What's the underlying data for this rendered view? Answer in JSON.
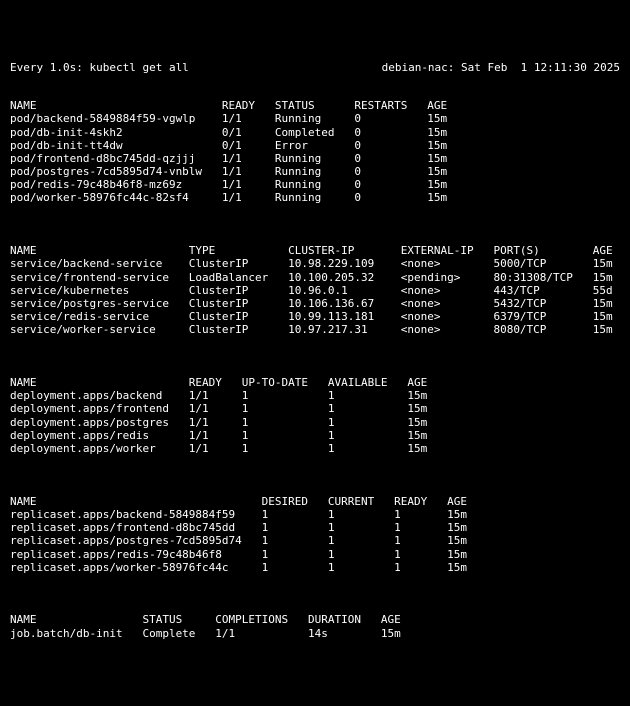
{
  "header": {
    "left": "Every 1.0s: kubectl get all",
    "right": "debian-nac: Sat Feb  1 12:11:30 2025"
  },
  "pods": {
    "headers": [
      "NAME",
      "READY",
      "STATUS",
      "RESTARTS",
      "AGE"
    ],
    "rows": [
      [
        "pod/backend-5849884f59-vgwlp",
        "1/1",
        "Running",
        "0",
        "15m"
      ],
      [
        "pod/db-init-4skh2",
        "0/1",
        "Completed",
        "0",
        "15m"
      ],
      [
        "pod/db-init-tt4dw",
        "0/1",
        "Error",
        "0",
        "15m"
      ],
      [
        "pod/frontend-d8bc745dd-qzjjj",
        "1/1",
        "Running",
        "0",
        "15m"
      ],
      [
        "pod/postgres-7cd5895d74-vnblw",
        "1/1",
        "Running",
        "0",
        "15m"
      ],
      [
        "pod/redis-79c48b46f8-mz69z",
        "1/1",
        "Running",
        "0",
        "15m"
      ],
      [
        "pod/worker-58976fc44c-82sf4",
        "1/1",
        "Running",
        "0",
        "15m"
      ]
    ]
  },
  "services": {
    "headers": [
      "NAME",
      "TYPE",
      "CLUSTER-IP",
      "EXTERNAL-IP",
      "PORT(S)",
      "AGE"
    ],
    "rows": [
      [
        "service/backend-service",
        "ClusterIP",
        "10.98.229.109",
        "<none>",
        "5000/TCP",
        "15m"
      ],
      [
        "service/frontend-service",
        "LoadBalancer",
        "10.100.205.32",
        "<pending>",
        "80:31308/TCP",
        "15m"
      ],
      [
        "service/kubernetes",
        "ClusterIP",
        "10.96.0.1",
        "<none>",
        "443/TCP",
        "55d"
      ],
      [
        "service/postgres-service",
        "ClusterIP",
        "10.106.136.67",
        "<none>",
        "5432/TCP",
        "15m"
      ],
      [
        "service/redis-service",
        "ClusterIP",
        "10.99.113.181",
        "<none>",
        "6379/TCP",
        "15m"
      ],
      [
        "service/worker-service",
        "ClusterIP",
        "10.97.217.31",
        "<none>",
        "8080/TCP",
        "15m"
      ]
    ]
  },
  "deployments": {
    "headers": [
      "NAME",
      "READY",
      "UP-TO-DATE",
      "AVAILABLE",
      "AGE"
    ],
    "rows": [
      [
        "deployment.apps/backend",
        "1/1",
        "1",
        "1",
        "15m"
      ],
      [
        "deployment.apps/frontend",
        "1/1",
        "1",
        "1",
        "15m"
      ],
      [
        "deployment.apps/postgres",
        "1/1",
        "1",
        "1",
        "15m"
      ],
      [
        "deployment.apps/redis",
        "1/1",
        "1",
        "1",
        "15m"
      ],
      [
        "deployment.apps/worker",
        "1/1",
        "1",
        "1",
        "15m"
      ]
    ]
  },
  "replicasets": {
    "headers": [
      "NAME",
      "DESIRED",
      "CURRENT",
      "READY",
      "AGE"
    ],
    "rows": [
      [
        "replicaset.apps/backend-5849884f59",
        "1",
        "1",
        "1",
        "15m"
      ],
      [
        "replicaset.apps/frontend-d8bc745dd",
        "1",
        "1",
        "1",
        "15m"
      ],
      [
        "replicaset.apps/postgres-7cd5895d74",
        "1",
        "1",
        "1",
        "15m"
      ],
      [
        "replicaset.apps/redis-79c48b46f8",
        "1",
        "1",
        "1",
        "15m"
      ],
      [
        "replicaset.apps/worker-58976fc44c",
        "1",
        "1",
        "1",
        "15m"
      ]
    ]
  },
  "jobs": {
    "headers": [
      "NAME",
      "STATUS",
      "COMPLETIONS",
      "DURATION",
      "AGE"
    ],
    "rows": [
      [
        "job.batch/db-init",
        "Complete",
        "1/1",
        "14s",
        "15m"
      ]
    ]
  }
}
